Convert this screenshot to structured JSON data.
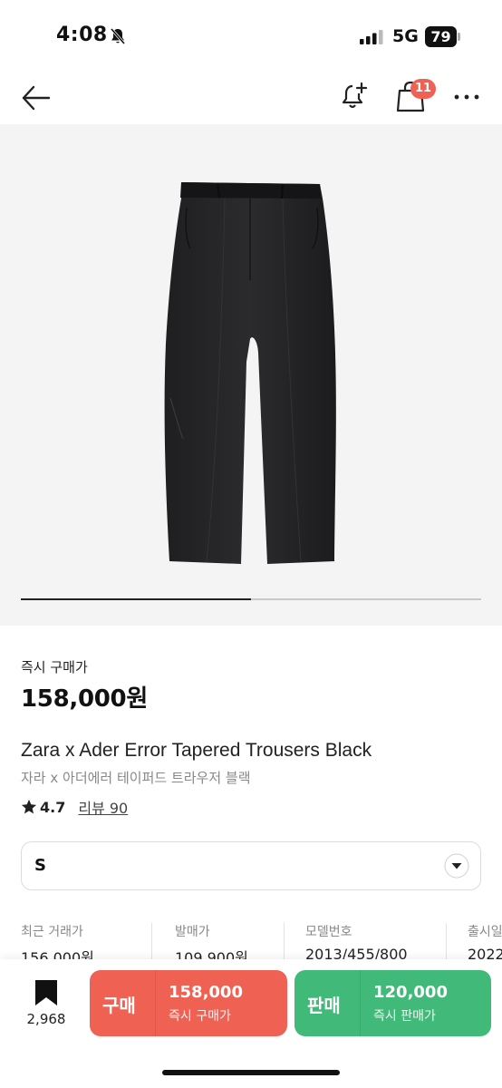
{
  "status_bar": {
    "time": "4:08",
    "network": "5G",
    "battery": "79"
  },
  "nav": {
    "cart_badge": "11"
  },
  "gallery": {
    "progress": 0.5
  },
  "price": {
    "label": "즉시 구매가",
    "value": "158,000원"
  },
  "product": {
    "name_en": "Zara x Ader Error Tapered Trousers Black",
    "name_ko": "자라 x 아더에러 테이퍼드 트라우저 블랙",
    "rating": "4.7",
    "review_text": "리뷰 90"
  },
  "size_select": {
    "value": "S"
  },
  "info": [
    {
      "label": "최근 거래가",
      "value": "156,000원"
    },
    {
      "label": "발매가",
      "value": "109,900원"
    },
    {
      "label": "모델번호",
      "value": "2013/455/800"
    },
    {
      "label": "출시일",
      "value": "2022"
    }
  ],
  "bottom_bar": {
    "bookmark_count": "2,968",
    "buy": {
      "label": "구매",
      "price": "158,000",
      "sub": "즉시 구매가"
    },
    "sell": {
      "label": "판매",
      "price": "120,000",
      "sub": "즉시 판매가"
    }
  },
  "colors": {
    "buy": "#ef6253",
    "sell": "#41b979",
    "badge": "#ef6253"
  }
}
